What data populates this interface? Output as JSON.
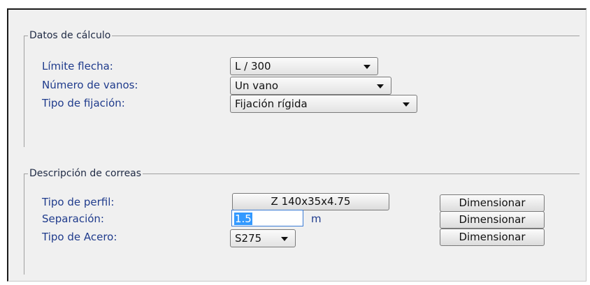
{
  "calc": {
    "title": "Datos de cálculo",
    "fields": [
      {
        "label": "Límite flecha:",
        "value": "L / 300"
      },
      {
        "label": "Número de vanos:",
        "value": "Un vano"
      },
      {
        "label": "Tipo de fijación:",
        "value": "Fijación rígida"
      }
    ]
  },
  "purlins": {
    "title": "Descripción de correas",
    "profile": {
      "label": "Tipo de perfil:",
      "value": "Z 140x35x4.75"
    },
    "spacing": {
      "label": "Separación:",
      "value": "1.5",
      "unit": "m"
    },
    "steel": {
      "label": "Tipo de Acero:",
      "value": "S275"
    },
    "dimension_label": "Dimensionar"
  }
}
